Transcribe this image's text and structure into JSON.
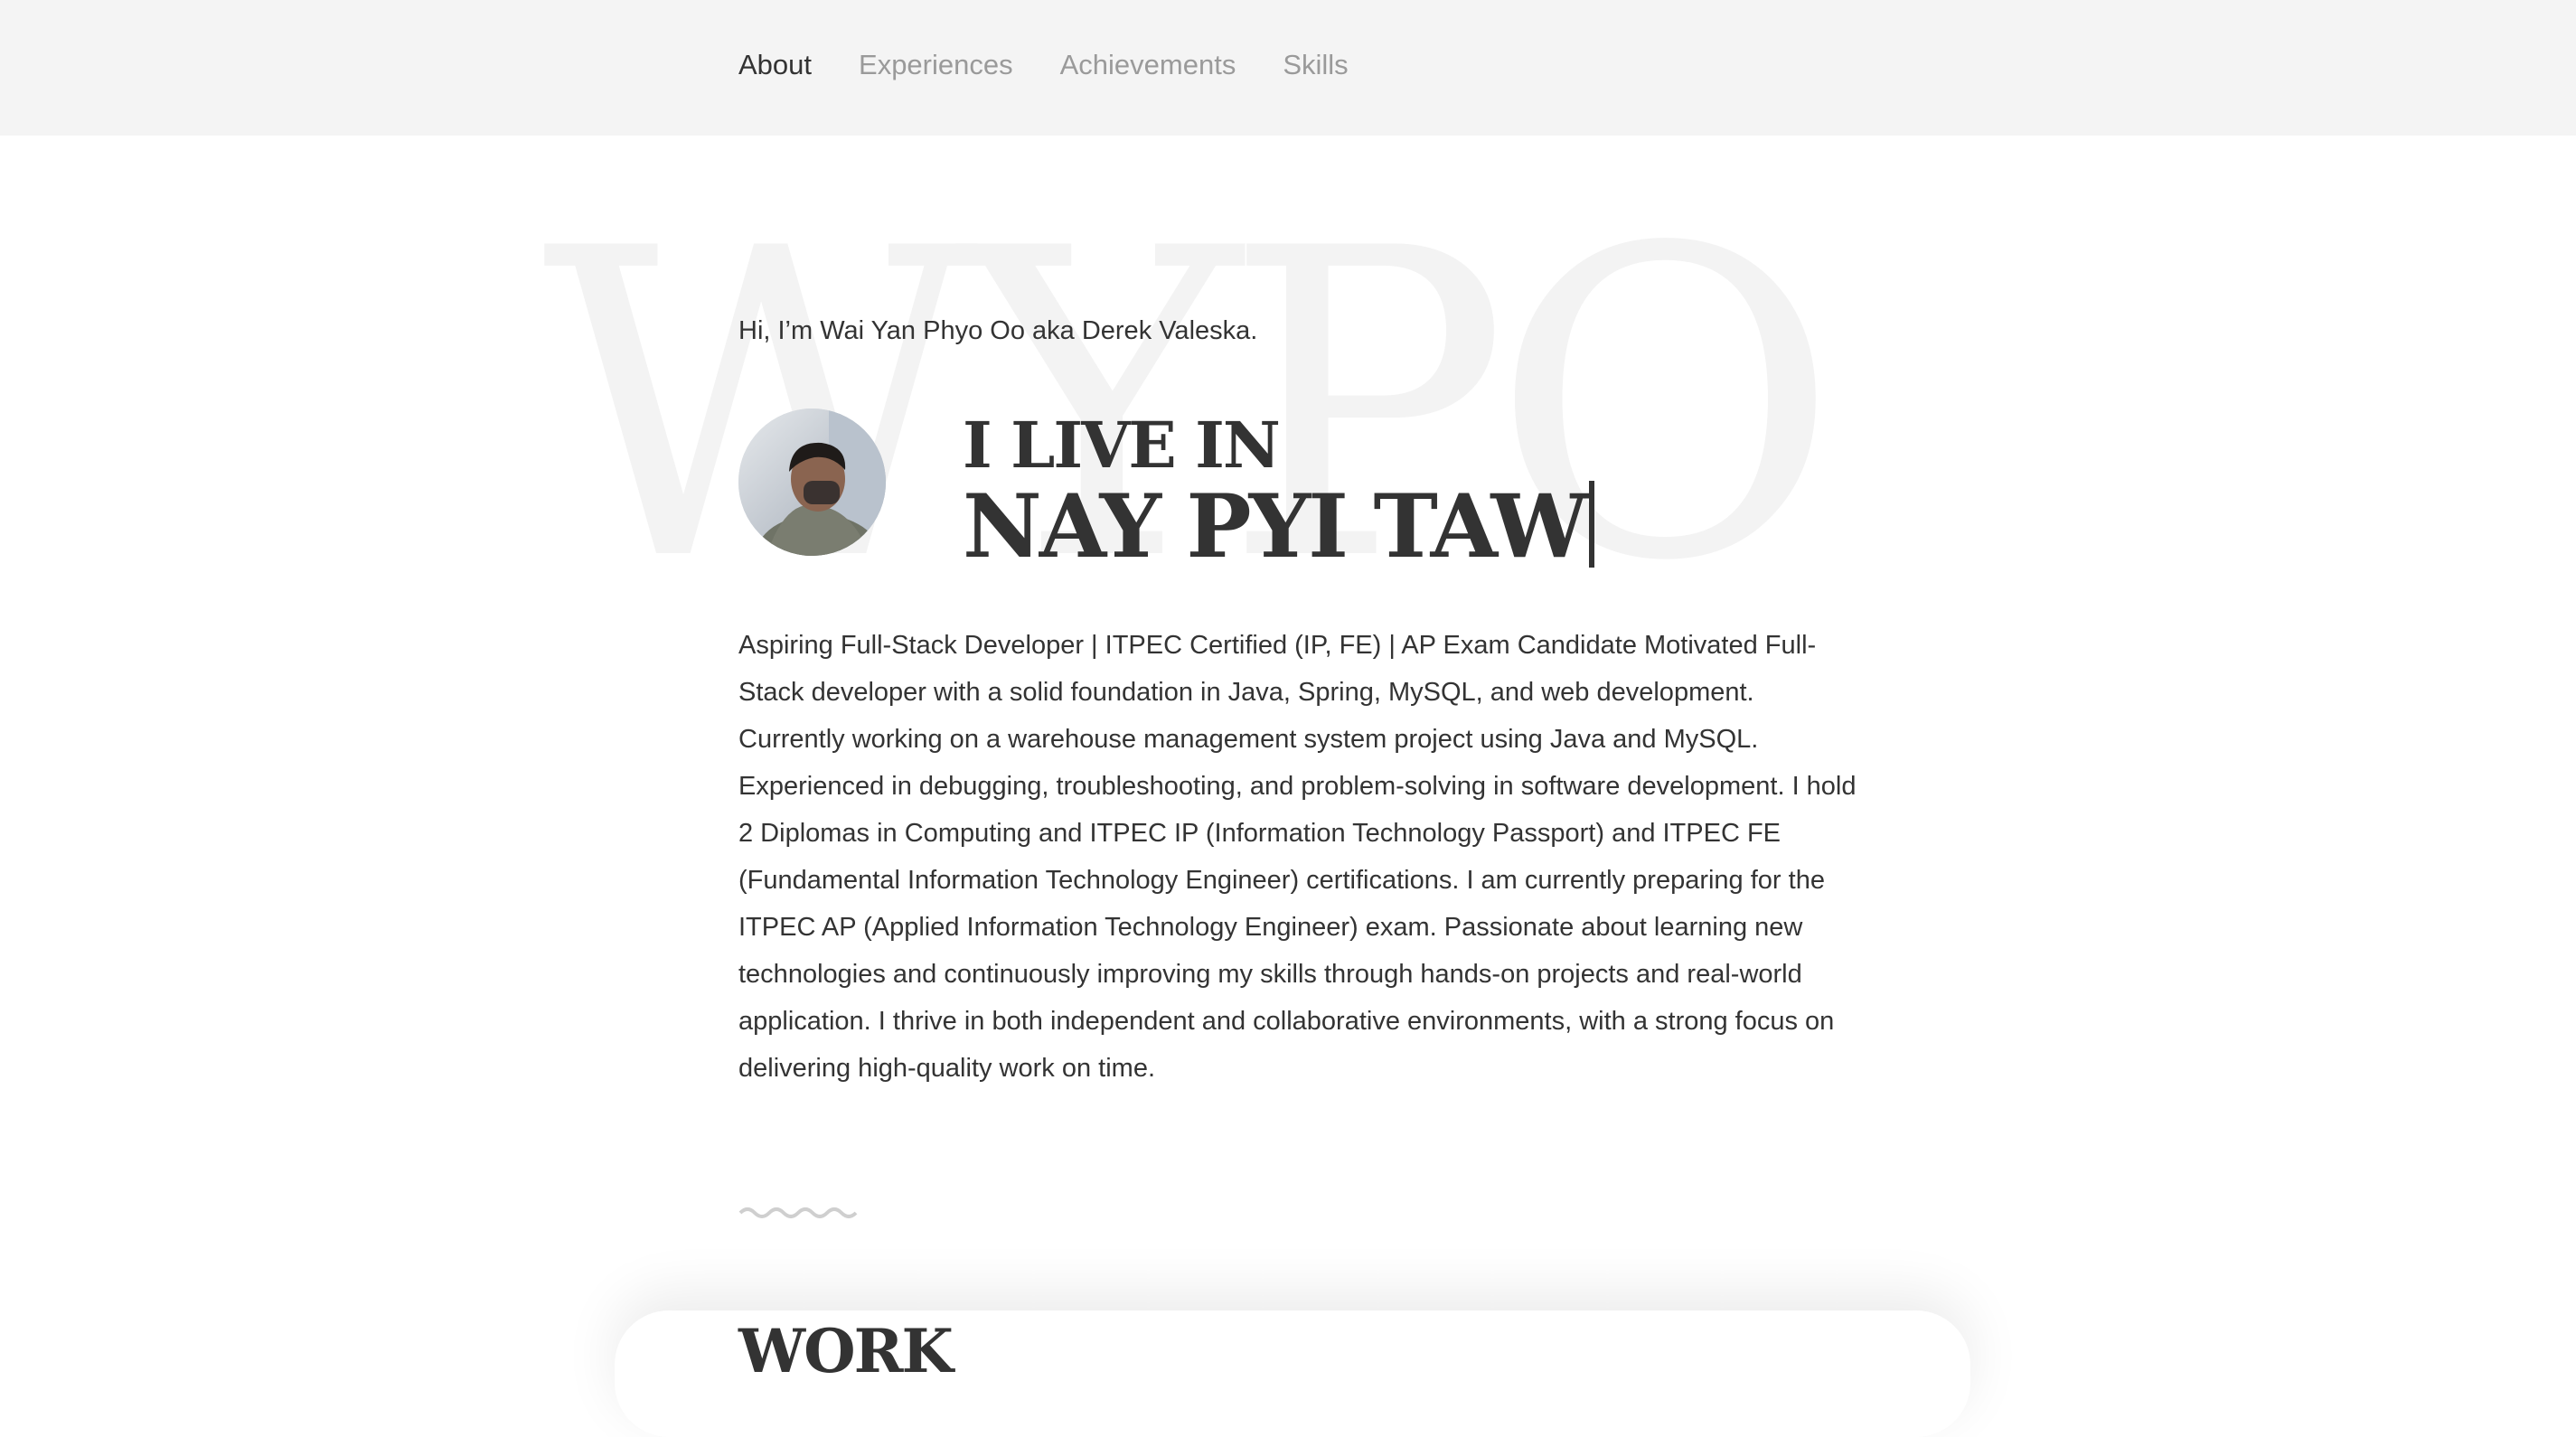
{
  "nav": {
    "items": [
      "About",
      "Experiences",
      "Achievements",
      "Skills"
    ]
  },
  "hero": {
    "watermark": "WYPO",
    "greeting": "Hi, I’m Wai Yan Phyo Oo aka Derek Valeska.",
    "live_prefix": "I LIVE IN",
    "location": "NAY PYI TAW"
  },
  "bio": {
    "text": "Aspiring Full-Stack Developer | ITPEC Certified (IP, FE) | AP Exam Candidate Motivated Full-Stack developer with a solid foundation in Java, Spring, MySQL, and web development. Currently working on a warehouse management system project using Java and MySQL. Experienced in debugging, troubleshooting, and problem-solving in software development. I hold 2 Diplomas in Computing and ITPEC IP (Information Technology Passport) and ITPEC FE (Fundamental Information Technology Engineer) certifications. I am currently preparing for the ITPEC AP (Applied Information Technology Engineer) exam. Passionate about learning new technologies and continuously improving my skills through hands-on projects and real-world application. I thrive in both independent and collaborative environments, with a strong focus on delivering high-quality work on time."
  },
  "sections": {
    "work_title": "WORK"
  },
  "colors": {
    "text": "#333333",
    "nav_inactive": "#9a9a9a",
    "topbar_bg": "#f4f4f4",
    "watermark": "#f3f3f3"
  }
}
